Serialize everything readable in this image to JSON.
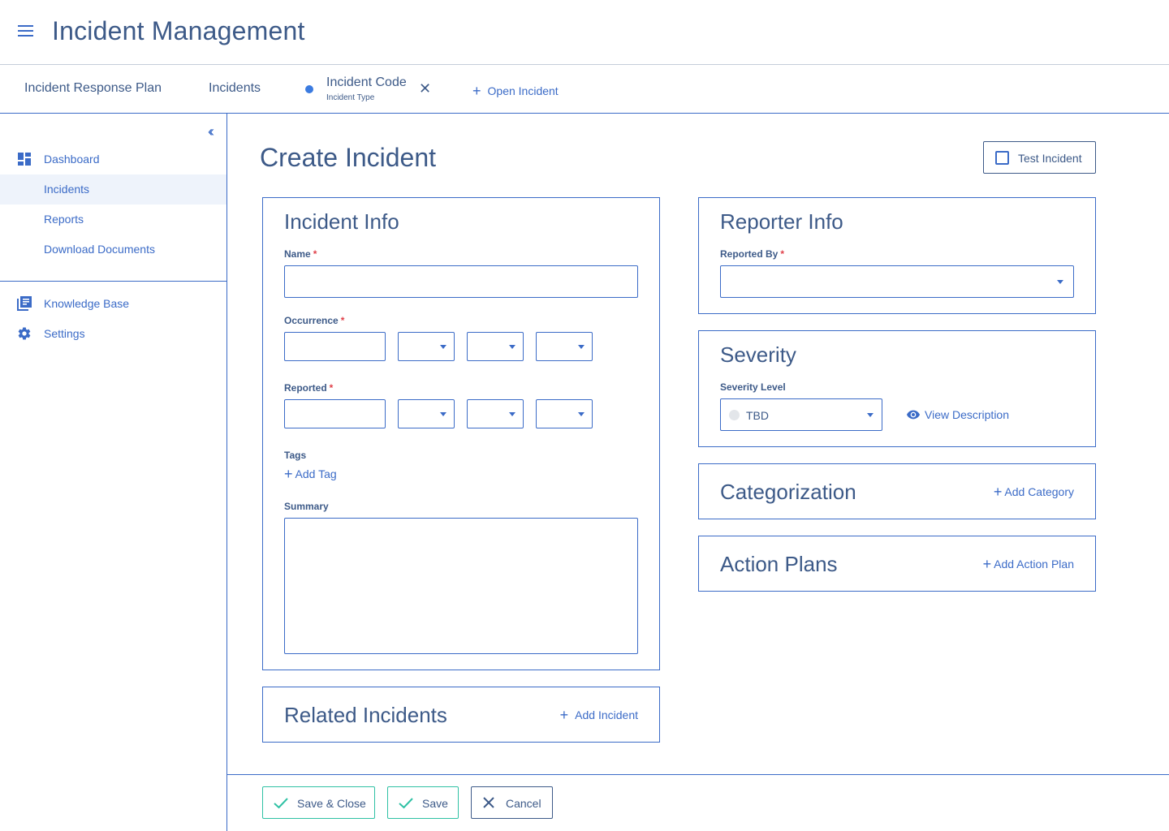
{
  "header": {
    "title": "Incident Management",
    "menu_icon": "hamburger-menu-icon"
  },
  "tabs": {
    "items": [
      {
        "label": "Incident Response Plan"
      },
      {
        "label": "Incidents"
      }
    ],
    "active": {
      "title": "Incident Code",
      "subtitle": "Incident Type"
    },
    "open_incident_label": "Open Incident"
  },
  "sidebar": {
    "items": [
      {
        "label": "Dashboard",
        "icon": "dashboard-icon"
      },
      {
        "label": "Incidents"
      },
      {
        "label": "Reports"
      },
      {
        "label": "Download Documents"
      },
      {
        "label": "Knowledge Base",
        "icon": "book-icon"
      },
      {
        "label": "Settings",
        "icon": "gear-icon"
      }
    ],
    "active_index": 1
  },
  "main": {
    "title": "Create Incident",
    "test_incident_label": "Test Incident",
    "incident_info": {
      "title": "Incident Info",
      "name_label": "Name",
      "occurrence_label": "Occurrence",
      "reported_label": "Reported",
      "tags_label": "Tags",
      "add_tag_label": "Add Tag",
      "summary_label": "Summary",
      "required_mark": "*"
    },
    "related_incidents": {
      "title": "Related Incidents",
      "add_label": "Add Incident"
    },
    "reporter_info": {
      "title": "Reporter Info",
      "reported_by_label": "Reported By"
    },
    "severity": {
      "title": "Severity",
      "level_label": "Severity Level",
      "level_value": "TBD",
      "view_description_label": "View Description"
    },
    "categorization": {
      "title": "Categorization",
      "add_label": "Add Category"
    },
    "action_plans": {
      "title": "Action Plans",
      "add_label": "Add Action Plan"
    }
  },
  "footer": {
    "save_close_label": "Save & Close",
    "save_label": "Save",
    "cancel_label": "Cancel"
  },
  "colors": {
    "accent": "#3b6bc7",
    "text": "#3d5a88",
    "success": "#2fc1a4",
    "required": "#e0414a"
  }
}
